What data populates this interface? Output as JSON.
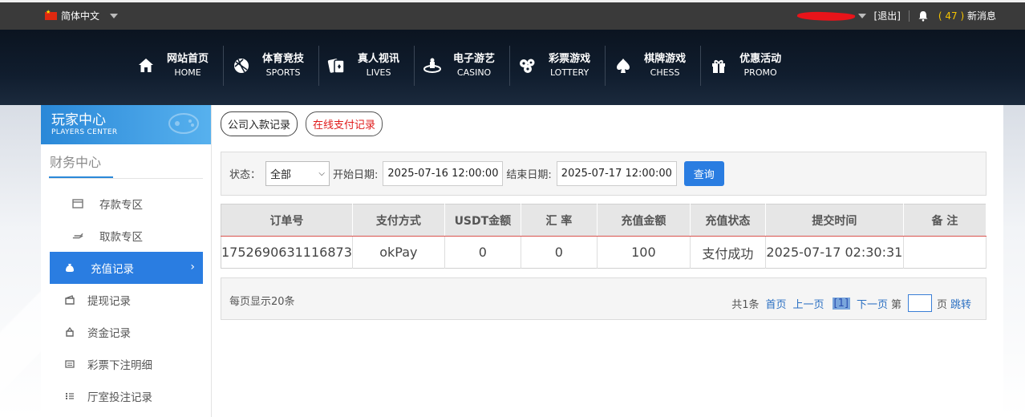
{
  "topbar": {
    "language": "简体中文",
    "logout": "[退出]",
    "message_count": "( 47 )",
    "message_label": "新消息"
  },
  "nav": [
    {
      "cn": "网站首页",
      "en": "HOME",
      "icon": "home-icon"
    },
    {
      "cn": "体育竞技",
      "en": "SPORTS",
      "icon": "ball-icon"
    },
    {
      "cn": "真人视讯",
      "en": "LIVES",
      "icon": "cards-icon"
    },
    {
      "cn": "电子游艺",
      "en": "CASINO",
      "icon": "slot-icon"
    },
    {
      "cn": "彩票游戏",
      "en": "LOTTERY",
      "icon": "lottery-balls-icon"
    },
    {
      "cn": "棋牌游戏",
      "en": "CHESS",
      "icon": "spade-icon"
    },
    {
      "cn": "优惠活动",
      "en": "PROMO",
      "icon": "gift-icon"
    }
  ],
  "sidebar": {
    "title_cn": "玩家中心",
    "title_en": "PLAYERS CENTER",
    "section": "财务中心",
    "items": [
      {
        "label": "存款专区",
        "icon": "deposit-icon"
      },
      {
        "label": "取款专区",
        "icon": "withdraw-icon"
      },
      {
        "label": "充值记录",
        "icon": "money-bag-icon",
        "active": true
      },
      {
        "label": "提现记录",
        "icon": "wallet-icon"
      },
      {
        "label": "资金记录",
        "icon": "funds-icon"
      },
      {
        "label": "彩票下注明细",
        "icon": "list-icon"
      },
      {
        "label": "厅室投注记录",
        "icon": "list-bullets-icon"
      }
    ]
  },
  "tabs": [
    {
      "label": "公司入款记录"
    },
    {
      "label": "在线支付记录"
    }
  ],
  "filter": {
    "status_label": "状态：",
    "status_value": "全部",
    "start_label": "开始日期:",
    "start_value": "2025-07-16 12:00:00",
    "end_label": "结束日期:",
    "end_value": "2025-07-17 12:00:00",
    "query_button": "查询"
  },
  "table": {
    "headers": [
      "订单号",
      "支付方式",
      "USDT金额",
      "汇 率",
      "充值金额",
      "充值状态",
      "提交时间",
      "备 注"
    ],
    "rows": [
      [
        "1752690631116873",
        "okPay",
        "0",
        "0",
        "100",
        "支付成功",
        "2025-07-17 02:30:31",
        ""
      ]
    ]
  },
  "pager": {
    "per_page": "每页显示20条",
    "total": "共1条",
    "first": "首页",
    "prev": "上一页",
    "current": "[1]",
    "next": "下一页",
    "page_prefix": "第",
    "page_suffix": "页",
    "jump": "跳转"
  },
  "colors": {
    "accent": "#2a7de1",
    "alert_red": "#e01b1b",
    "message_yellow": "#f5c300"
  }
}
